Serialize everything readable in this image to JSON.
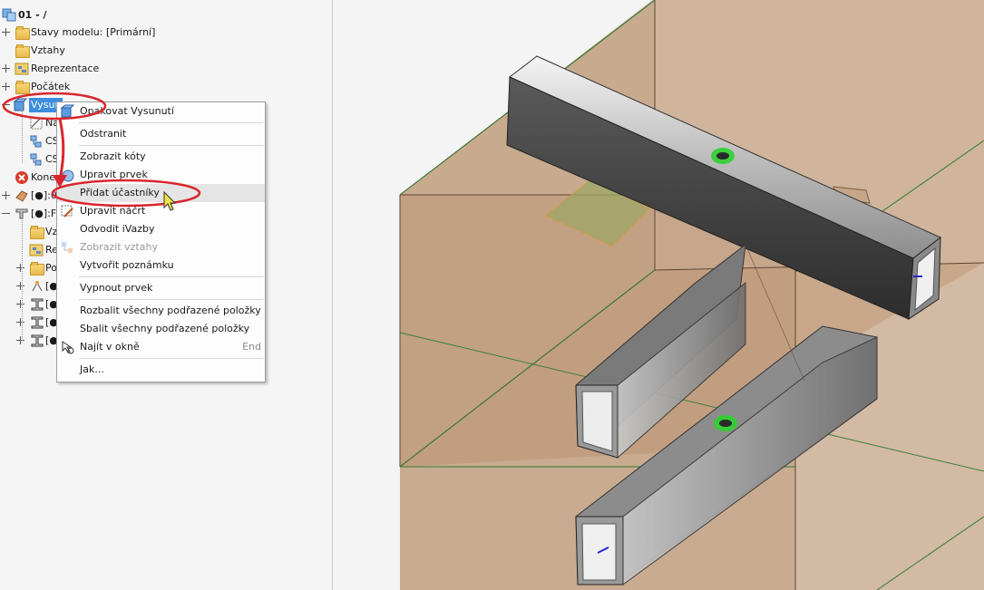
{
  "browser": {
    "root": "01 -  /",
    "items": [
      {
        "label": "Stavy modelu: [Primární]"
      },
      {
        "label": "Vztahy"
      },
      {
        "label": "Reprezentace"
      },
      {
        "label": "Počátek"
      },
      {
        "label": "Vysun"
      },
      {
        "label": "Na"
      },
      {
        "label": "CS"
      },
      {
        "label": "CS"
      },
      {
        "label": "Konec"
      },
      {
        "label": "[●]:0"
      },
      {
        "label": "[●]:Fr"
      },
      {
        "label": "Vz"
      },
      {
        "label": "Re"
      },
      {
        "label": "Po"
      },
      {
        "label": "[●"
      },
      {
        "label": "[●"
      },
      {
        "label": "[●"
      },
      {
        "label": "[●"
      }
    ]
  },
  "context_menu": {
    "items": [
      {
        "label": "Opakovat Vysunutí",
        "icon": "extrude-icon"
      },
      {
        "label": "Odstranit"
      },
      {
        "label": "Zobrazit kóty"
      },
      {
        "label": "Upravit prvek",
        "icon": "edit-feature-icon"
      },
      {
        "label": "Přidat účastníky",
        "highlighted": true
      },
      {
        "label": "Upravit náčrt",
        "icon": "edit-sketch-icon"
      },
      {
        "label": "Odvodit iVazby"
      },
      {
        "label": "Zobrazit vztahy",
        "disabled": true,
        "icon": "relations-icon"
      },
      {
        "label": "Vytvořit poznámku"
      },
      {
        "label": "Vypnout prvek"
      },
      {
        "label": "Rozbalit všechny podřazené položky"
      },
      {
        "label": "Sbalit všechny podřazené položky"
      },
      {
        "label": "Najít v okně",
        "shortcut": "End",
        "icon": "find-in-window-icon"
      },
      {
        "label": "Jak..."
      }
    ]
  },
  "colors": {
    "annotation_red": "#d9262c",
    "highlight_blue": "#3d8ee0",
    "extrude_body": "#b98758",
    "grid_green": "#2f9a3a"
  }
}
